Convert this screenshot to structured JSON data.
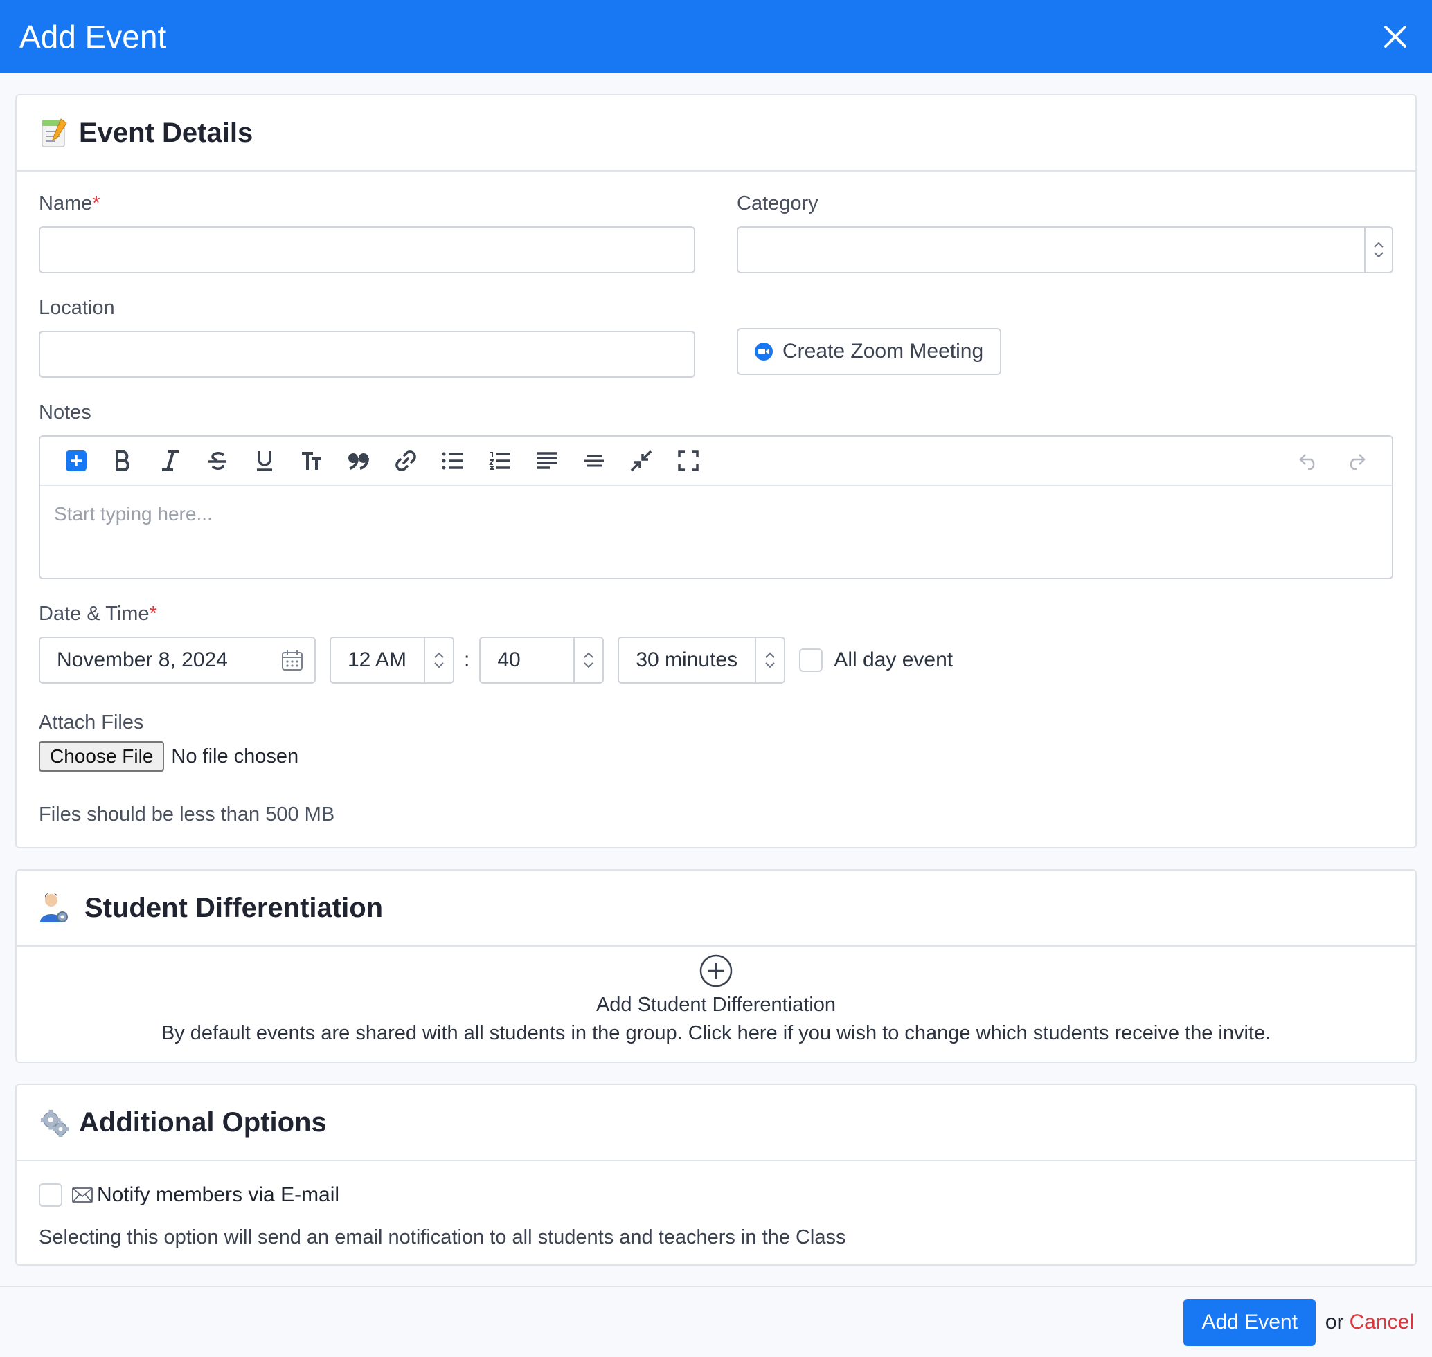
{
  "header": {
    "title": "Add Event"
  },
  "event_details": {
    "title": "Event Details",
    "name_label": "Name",
    "required_mark": "*",
    "category_label": "Category",
    "location_label": "Location",
    "zoom_button": "Create Zoom Meeting",
    "notes_label": "Notes",
    "notes_placeholder": "Start typing here...",
    "datetime_label": "Date & Time",
    "date_value": "November 8, 2024",
    "hour_value": "12 AM",
    "colon": ":",
    "minute_value": "40",
    "duration_value": "30 minutes",
    "all_day_label": "All day event",
    "attach_label": "Attach Files",
    "choose_file": "Choose File",
    "no_file": "No file chosen",
    "file_hint": "Files should be less than 500 MB"
  },
  "student_diff": {
    "title": "Student Differentiation",
    "add_title": "Add Student Differentiation",
    "description": "By default events are shared with all students in the group. Click here if you wish to change which students receive the invite."
  },
  "additional": {
    "title": "Additional Options",
    "notify_label": "Notify members via E-mail",
    "notify_hint": "Selecting this option will send an email notification to all students and teachers in the Class"
  },
  "footer": {
    "submit": "Add Event",
    "or": "or",
    "cancel": "Cancel"
  },
  "colors": {
    "brand": "#1877f2",
    "danger": "#e0343b"
  }
}
